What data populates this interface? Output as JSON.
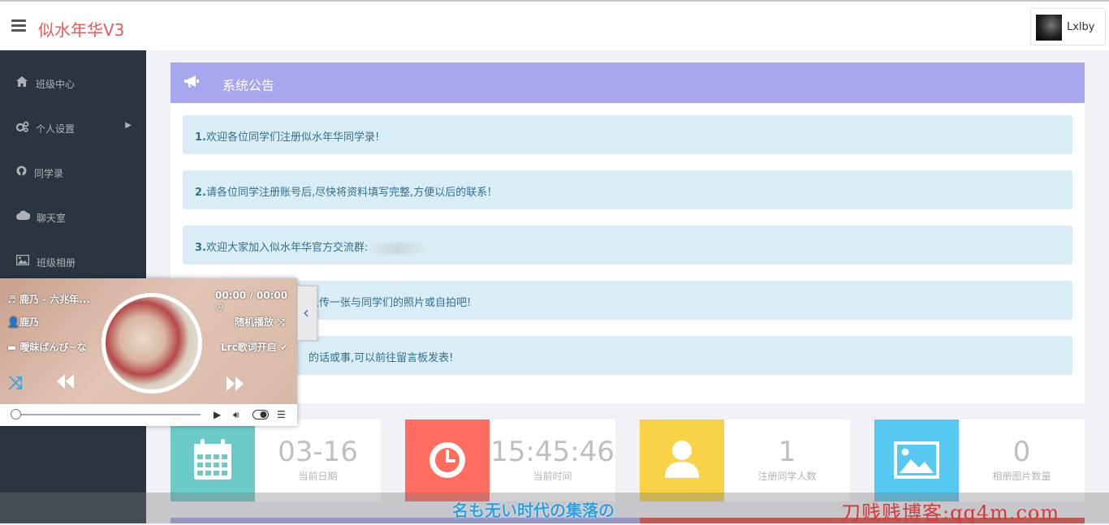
{
  "app": {
    "brand": "似水年华V3"
  },
  "user": {
    "name": "Lxlby"
  },
  "sidebar": {
    "items": [
      {
        "label": "班级中心",
        "icon": "home-icon"
      },
      {
        "label": "个人设置",
        "icon": "gears-icon",
        "has_submenu": true
      },
      {
        "label": "同学录",
        "icon": "github-icon"
      },
      {
        "label": "聊天室",
        "icon": "cloud-icon"
      },
      {
        "label": "班级相册",
        "icon": "picture-icon"
      }
    ]
  },
  "announcement": {
    "title": "系统公告",
    "items": [
      {
        "num": "1.",
        "text": "欢迎各位同学们注册似水年华同学录!"
      },
      {
        "num": "2.",
        "text": "请各位同学注册账号后,尽快将资料填写完整,方便以后的联系!"
      },
      {
        "num": "3.",
        "text": "欢迎大家加入似水年华官方交流群:"
      },
      {
        "num": "",
        "text": "上传一张与同学们的照片或自拍吧!"
      },
      {
        "num": "",
        "text": "的话或事,可以前往留言板发表!"
      }
    ]
  },
  "stats": [
    {
      "value": "03-16",
      "label": "当前日期",
      "color": "#6ccac9",
      "icon": "calendar-icon"
    },
    {
      "value": "15:45:46",
      "label": "当前时间",
      "color": "#ff6c60",
      "icon": "clock-icon"
    },
    {
      "value": "1",
      "label": "注册同学人数",
      "color": "#f8d347",
      "icon": "user-icon"
    },
    {
      "value": "0",
      "label": "相册图片数量",
      "color": "#57c8f2",
      "icon": "image-icon"
    }
  ],
  "player": {
    "song": "鹿乃 - 六兆年...",
    "artist": "鹿乃",
    "album": "曖昧ばんび~な",
    "time": "00:00 / 00:00",
    "mode": "随机播放",
    "lyric_status": "Lrc歌词开启"
  },
  "lyric_line": "名も无い时代の集落の",
  "watermark": "刀贱贱博客:qq4m.com"
}
